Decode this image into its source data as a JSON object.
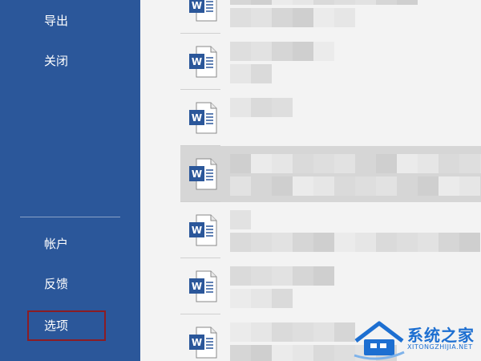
{
  "sidebar": {
    "items": [
      {
        "label": "导出"
      },
      {
        "label": "关闭"
      },
      {
        "label": "帐户"
      },
      {
        "label": "反馈"
      },
      {
        "label": "选项"
      }
    ],
    "background": "#2b579a",
    "highlight_color": "#8b1c24"
  },
  "files": {
    "icon": "word-document-icon",
    "selected_index": 3
  },
  "watermark": {
    "title": "系统之家",
    "subtitle": "XITONGZHIJIA.NET",
    "brand_color": "#1d6fd1"
  }
}
